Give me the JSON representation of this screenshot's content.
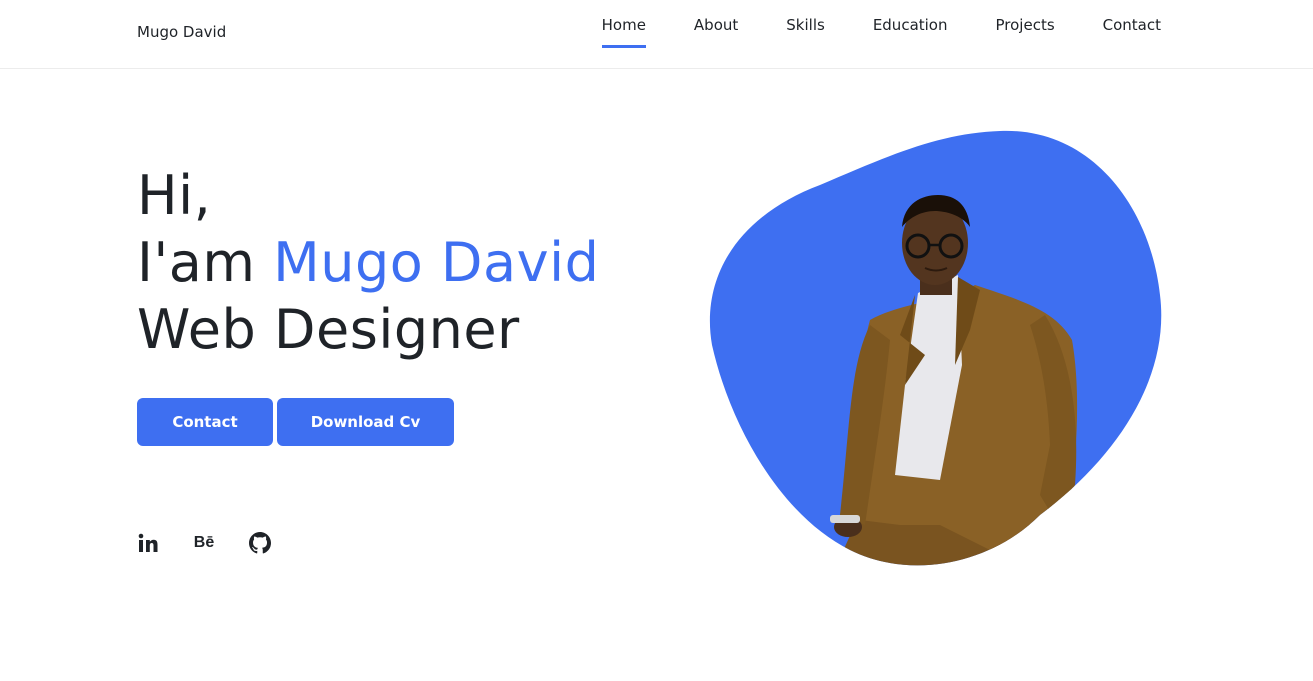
{
  "header": {
    "brand": "Mugo David",
    "nav": [
      {
        "label": "Home",
        "active": true
      },
      {
        "label": "About"
      },
      {
        "label": "Skills"
      },
      {
        "label": "Education"
      },
      {
        "label": "Projects"
      },
      {
        "label": "Contact"
      }
    ]
  },
  "hero": {
    "greeting": "Hi,",
    "intro_prefix": "I'am ",
    "name": "Mugo David",
    "role": "Web Designer",
    "buttons": {
      "contact": "Contact",
      "download_cv": "Download Cv"
    },
    "social": {
      "linkedin": "in",
      "behance": "Bē",
      "github_icon": "github-icon"
    }
  },
  "colors": {
    "accent": "#3e6ff1",
    "text": "#1f2328"
  }
}
